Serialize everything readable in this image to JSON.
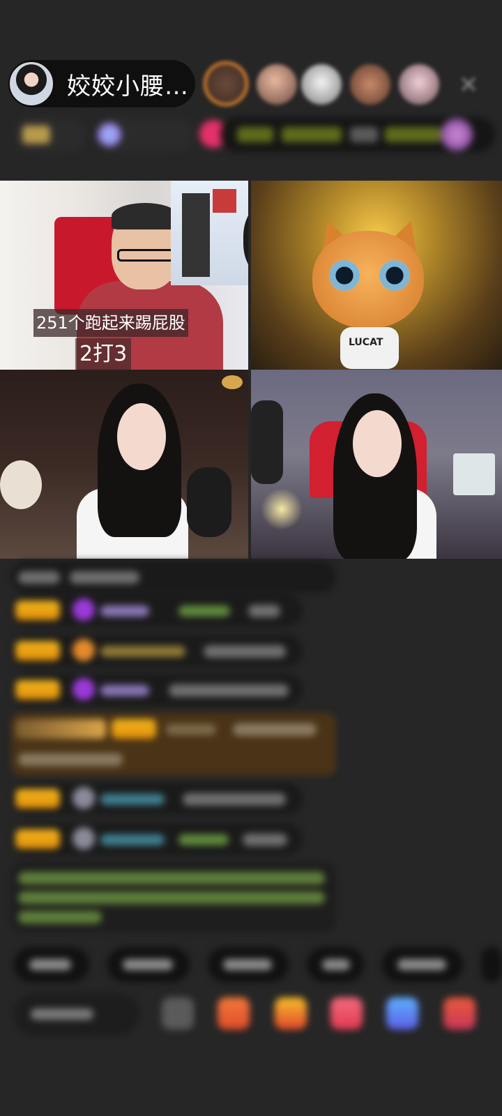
{
  "header": {
    "host_name": "姣姣小腰…",
    "close_glyph": "✕"
  },
  "video": {
    "caption_line1": "251个跑起来踢屁股",
    "caption_line2": "2打3",
    "cat_shirt_text": "LUCAT"
  },
  "colors": {
    "background": "#262626",
    "badge_gold": "#f2b51d",
    "chair_red": "#c7192b"
  }
}
